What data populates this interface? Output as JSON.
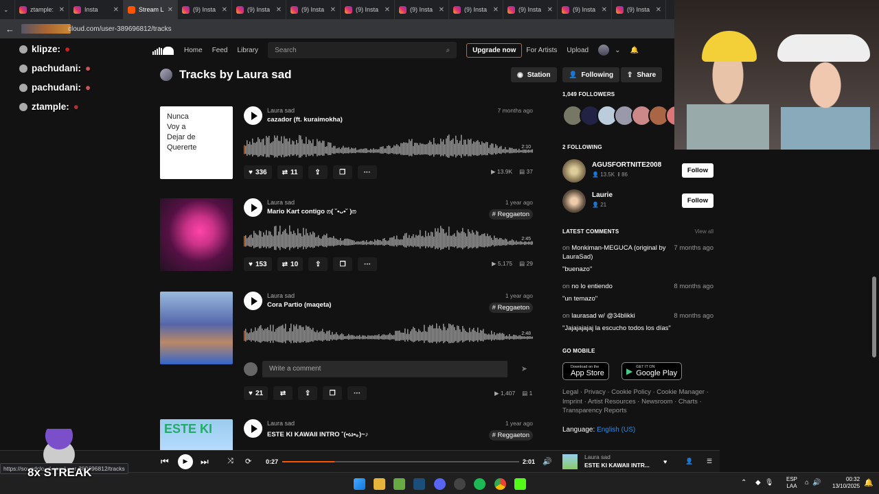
{
  "browser": {
    "tabs": [
      {
        "label": "ztample:",
        "active": false
      },
      {
        "label": "Insta",
        "active": false
      },
      {
        "label": "Stream L",
        "active": true
      },
      {
        "label": "(9) Insta",
        "active": false
      },
      {
        "label": "(9) Insta",
        "active": false
      },
      {
        "label": "(9) Insta",
        "active": false
      },
      {
        "label": "(9) Insta",
        "active": false
      },
      {
        "label": "(9) Insta",
        "active": false
      },
      {
        "label": "(9) Insta",
        "active": false
      },
      {
        "label": "(9) Insta",
        "active": false
      },
      {
        "label": "(9) Insta",
        "active": false
      },
      {
        "label": "(9) Insta",
        "active": false
      }
    ],
    "url": "cloud.com/user-389696812/tracks",
    "hover_url": "https://soundcloud.com/user-389696812/tracks"
  },
  "nav": {
    "home": "Home",
    "feed": "Feed",
    "library": "Library",
    "search_placeholder": "Search",
    "upgrade": "Upgrade now",
    "for_artists": "For Artists",
    "upload": "Upload"
  },
  "profile": {
    "title": "Tracks by Laura sad",
    "station": "Station",
    "following": "Following",
    "share": "Share"
  },
  "tracks": [
    {
      "artist": "Laura sad",
      "title": "cazador (ft. kuraimokha)",
      "date": "7 months ago",
      "genre": "",
      "duration": "2:10",
      "likes": "336",
      "reposts": "11",
      "plays": "13.9K",
      "comments": "37",
      "art_text": [
        "Nunca",
        "Voy a",
        "Dejar de",
        "Quererte"
      ]
    },
    {
      "artist": "Laura sad",
      "title": "Mario Kart contigo ෆ( ˘•ᴗ•˘ )ෆ",
      "date": "1 year ago",
      "genre": "# Reggaeton",
      "duration": "2:45",
      "likes": "153",
      "reposts": "10",
      "plays": "5,175",
      "comments": "29",
      "art_text": []
    },
    {
      "artist": "Laura sad",
      "title": "Cora Partio (maqeta)",
      "date": "1 year ago",
      "genre": "# Reggaeton",
      "duration": "2:48",
      "likes": "21",
      "reposts": "",
      "plays": "1,407",
      "comments": "1",
      "art_text": []
    },
    {
      "artist": "Laura sad",
      "title": "ESTE KI KAWAII INTRO ˚(•ω•｡)~♪",
      "date": "1 year ago",
      "genre": "# Reggaeton",
      "duration": "",
      "likes": "",
      "reposts": "",
      "plays": "",
      "comments": "",
      "art_text": [
        "ESTE KI"
      ]
    }
  ],
  "comment_box": {
    "placeholder": "Write a comment"
  },
  "sidebar": {
    "followers_label": "1,049 FOLLOWERS",
    "following_label": "2 FOLLOWING",
    "following": [
      {
        "name": "AGUSFORTNITE2008",
        "followers": "13.5K",
        "tracks": "86",
        "button": "Follow"
      },
      {
        "name": "Laurie",
        "followers": "21",
        "tracks": "",
        "button": "Follow"
      }
    ],
    "latest_label": "LATEST COMMENTS",
    "view_all": "View all",
    "comments": [
      {
        "on": "on",
        "track": "Monkiman-MEGUCA (original by LauraSad)",
        "date": "7 months ago",
        "text": "\"buenazo\""
      },
      {
        "on": "on",
        "track": "no lo entiendo",
        "date": "8 months ago",
        "text": "\"un temazo\""
      },
      {
        "on": "on",
        "track": "laurasad w/ @34blikki",
        "date": "8 months ago",
        "text": "\"Jajajajajaj la escucho todos los días\""
      }
    ],
    "mobile_label": "GO MOBILE",
    "appstore_small": "Download on the",
    "appstore": "App Store",
    "gplay_small": "GET IT ON",
    "gplay": "Google Play",
    "footer": "Legal · Privacy · Cookie Policy · Cookie Manager · Imprint · Artist Resources · Newsroom · Charts · Transparency Reports",
    "language_label": "Language:",
    "language": "English (US)"
  },
  "player": {
    "elapsed": "0:27",
    "total": "2:01",
    "progress": 0.22,
    "artist": "Laura sad",
    "title": "ESTE KI KAWAII INTR..."
  },
  "chat": [
    {
      "name": "klipze:"
    },
    {
      "name": "pachudani:"
    },
    {
      "name": "pachudani:"
    },
    {
      "name": "ztample:"
    }
  ],
  "overlay": {
    "streak": "8x STREAK"
  },
  "taskbar": {
    "lang1": "ESP",
    "lang2": "LAA",
    "time": "00:32",
    "date": "13/10/2025"
  },
  "colors": {
    "accent": "#ff5500",
    "bg": "#121212"
  }
}
